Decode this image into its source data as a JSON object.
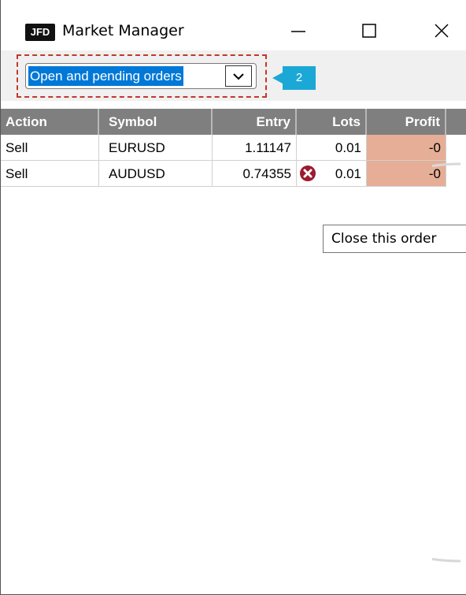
{
  "window": {
    "logo_text": "JFD",
    "title": "Market Manager",
    "minimize_icon": "minimize-icon",
    "maximize_icon": "maximize-icon",
    "close_icon": "close-icon"
  },
  "toolbar": {
    "order_filter": {
      "selected": "Open and pending orders",
      "dropdown_icon": "chevron-down-icon"
    },
    "callout_number": "2"
  },
  "table": {
    "columns": [
      "Action",
      "Symbol",
      "Entry",
      "Lots",
      "Profit"
    ],
    "rows": [
      {
        "action": "Sell",
        "symbol": "EURUSD",
        "entry": "1.11147",
        "lots": "0.01",
        "profit": "-0",
        "has_close_icon": false
      },
      {
        "action": "Sell",
        "symbol": "AUDUSD",
        "entry": "0.74355",
        "lots": "0.01",
        "profit": "-0",
        "has_close_icon": true
      }
    ]
  },
  "tooltip": {
    "text": "Close this order"
  },
  "colors": {
    "header_bg": "#7f7f7f",
    "profit_bg": "#e6ae96",
    "selection_bg": "#0078d7",
    "callout_bg": "#1ba8d6",
    "close_icon_color": "#9b1b2f",
    "highlight_border": "#c0392b"
  }
}
